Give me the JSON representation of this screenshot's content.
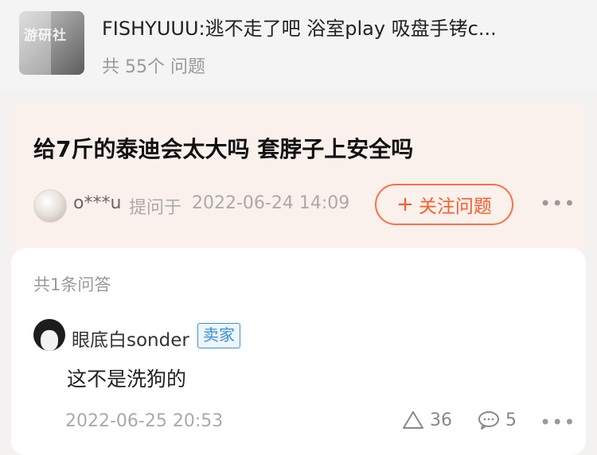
{
  "product": {
    "thumb_watermark": "游研社",
    "title": "FISHYUUU:逃不走了吧 浴室play 吸盘手铐c...",
    "count": "共 55个 问题"
  },
  "question": {
    "title": "给7斤的泰迪会太大吗 套脖子上安全吗",
    "asker": "o***u",
    "asked_prefix": "提问于",
    "asked_time": "2022-06-24 14:09",
    "follow_label": "关注问题",
    "follow_icon": "plus-icon",
    "more_icon": "more-dots-icon"
  },
  "answers": {
    "count": "共1条问答",
    "items": [
      {
        "author": "眼底白sonder",
        "badge": "卖家",
        "text": "这不是洗狗的",
        "time": "2022-06-25 20:53",
        "likes": "36",
        "comments": "5"
      }
    ]
  },
  "colors": {
    "accent": "#ff5a2a",
    "badge": "#3b8fd9",
    "question_bg": "#fbf1ec"
  }
}
